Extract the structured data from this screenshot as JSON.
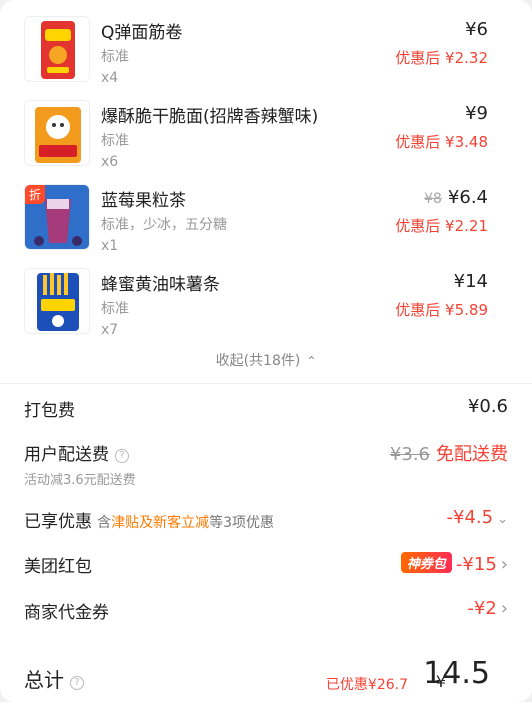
{
  "items": [
    {
      "name": "Q弹面筋卷",
      "spec": "标准",
      "qty": "x4",
      "price": "¥6",
      "orig_price": "",
      "discount": "优惠后 ¥2.32",
      "badge": ""
    },
    {
      "name": "爆酥脆干脆面(招牌香辣蟹味)",
      "spec": "标准",
      "qty": "x6",
      "price": "¥9",
      "orig_price": "",
      "discount": "优惠后 ¥3.48",
      "badge": ""
    },
    {
      "name": "蓝莓果粒茶",
      "spec": "标准，少冰，五分糖",
      "qty": "x1",
      "price": "¥6.4",
      "orig_price": "¥8",
      "discount": "优惠后 ¥2.21",
      "badge": "折"
    },
    {
      "name": "蜂蜜黄油味薯条",
      "spec": "标准",
      "qty": "x7",
      "price": "¥14",
      "orig_price": "",
      "discount": "优惠后 ¥5.89",
      "badge": ""
    }
  ],
  "collapse_label": "收起(共18件)",
  "fees": {
    "packing_label": "打包费",
    "packing_value": "¥0.6",
    "delivery_label": "用户配送费",
    "delivery_orig": "¥3.6",
    "delivery_value": "免配送费",
    "delivery_note": "活动减3.6元配送费"
  },
  "discounts": {
    "enjoyed_label": "已享优惠",
    "enjoyed_prefix": "含",
    "enjoyed_highlight": "津贴及新客立减",
    "enjoyed_suffix": "等3项优惠",
    "enjoyed_value": "-¥4.5",
    "redpacket_label": "美团红包",
    "redpacket_badge": "神券包",
    "redpacket_value": "-¥15",
    "voucher_label": "商家代金券",
    "voucher_value": "-¥2"
  },
  "total": {
    "label": "总计",
    "saved": "已优惠¥26.7",
    "currency": "¥",
    "amount": "14.5"
  },
  "colors": {
    "accent_red": "#f44336",
    "highlight_orange": "#ff7a00"
  }
}
